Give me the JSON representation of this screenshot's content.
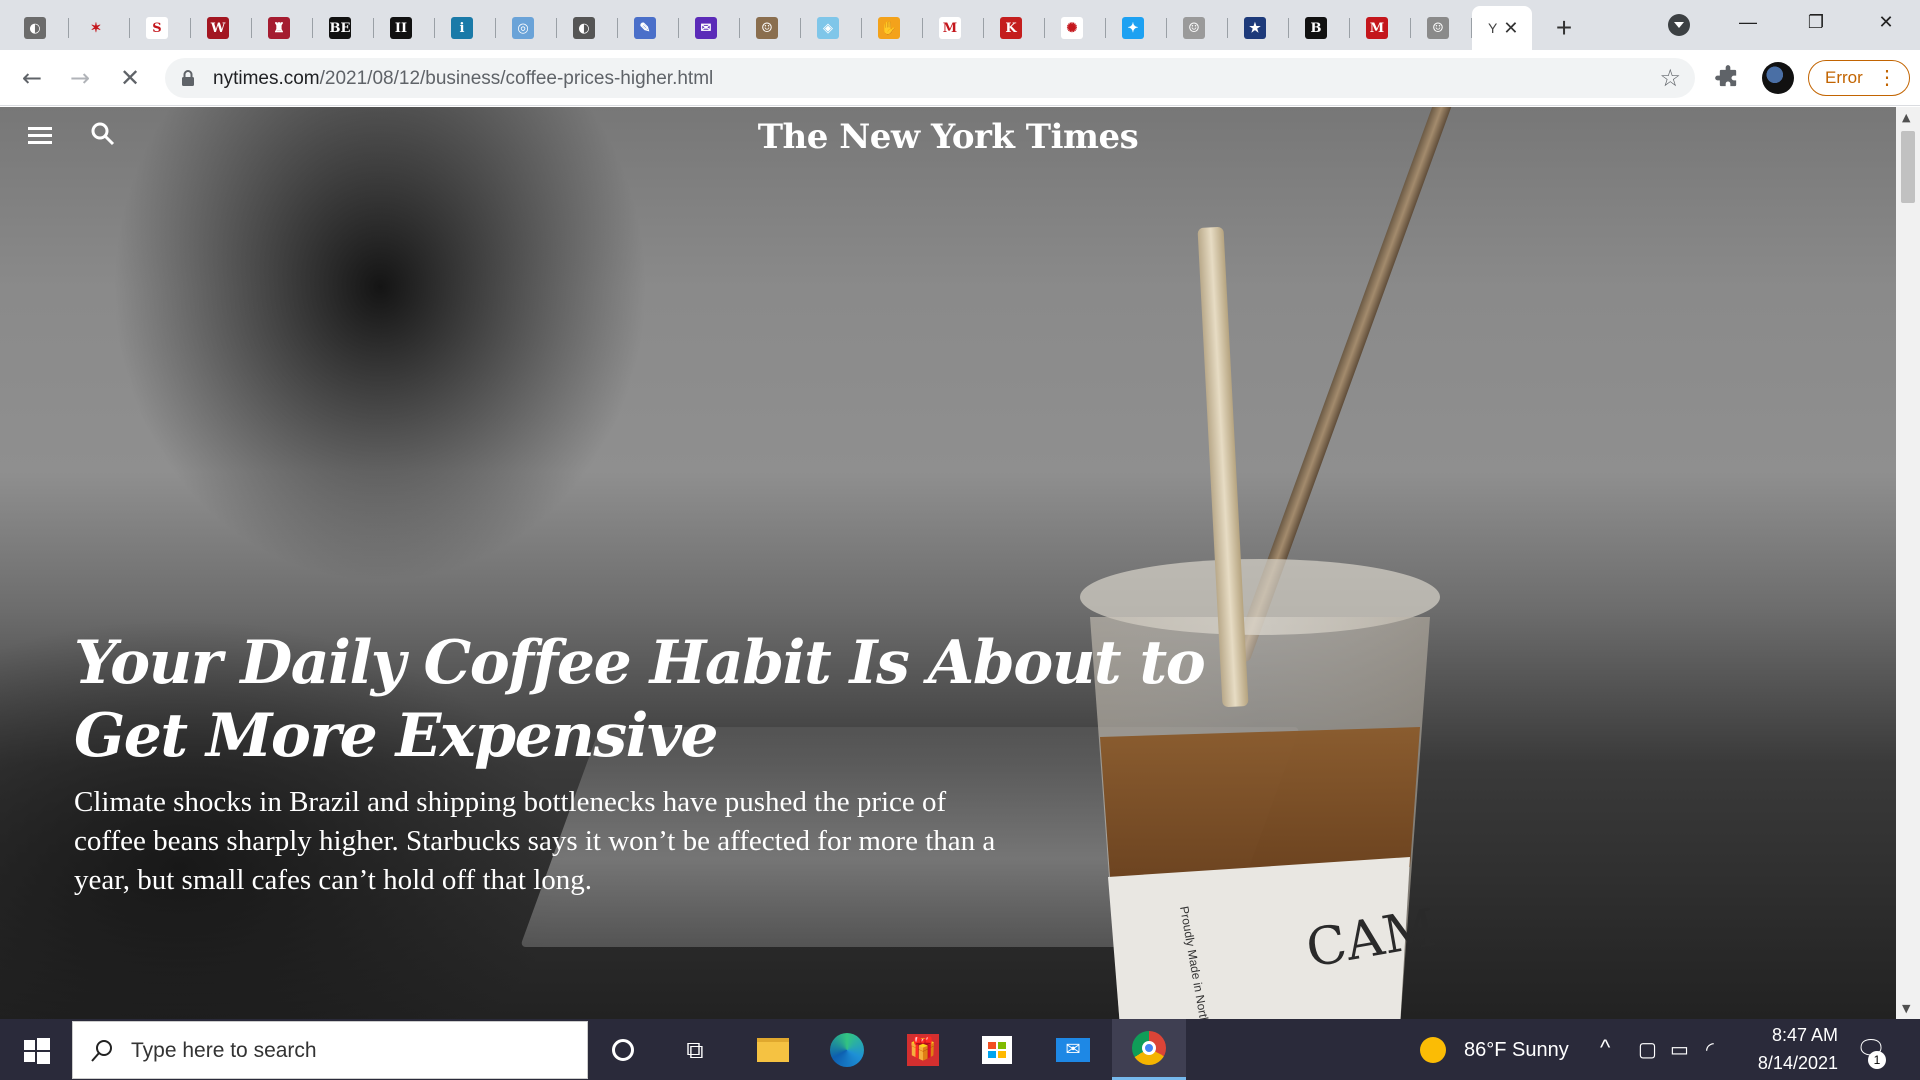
{
  "browser": {
    "tabs": [
      {
        "icon": "globe-icon",
        "bg": "#6b6b6b",
        "glyph": "◐"
      },
      {
        "icon": "stars-icon",
        "bg": "#dee1e6",
        "glyph": "✶"
      },
      {
        "icon": "sydney-icon",
        "bg": "#ffffff",
        "glyph": "S"
      },
      {
        "icon": "w-icon",
        "bg": "#a31621",
        "glyph": "W"
      },
      {
        "icon": "harvard-shield-icon",
        "bg": "#a51c30",
        "glyph": "♜"
      },
      {
        "icon": "be-icon",
        "bg": "#111111",
        "glyph": "BE"
      },
      {
        "icon": "ii-icon",
        "bg": "#111111",
        "glyph": "II"
      },
      {
        "icon": "invest-icon",
        "bg": "#1a7aa8",
        "glyph": "i"
      },
      {
        "icon": "un-icon",
        "bg": "#6aa3d8",
        "glyph": "◎"
      },
      {
        "icon": "globe-icon",
        "bg": "#555555",
        "glyph": "◐"
      },
      {
        "icon": "chat-icon",
        "bg": "#4a6fc9",
        "glyph": "✎"
      },
      {
        "icon": "mail-icon",
        "bg": "#5b2bb8",
        "glyph": "✉"
      },
      {
        "icon": "person-photo-icon",
        "bg": "#8a6e4e",
        "glyph": "☺"
      },
      {
        "icon": "shield-icon",
        "bg": "#7fc6e9",
        "glyph": "◈"
      },
      {
        "icon": "hand-icon",
        "bg": "#f3a21b",
        "glyph": "✋"
      },
      {
        "icon": "gmail-icon",
        "bg": "#ffffff",
        "glyph": "M"
      },
      {
        "icon": "k-icon",
        "bg": "#c41e1e",
        "glyph": "K"
      },
      {
        "icon": "nbc-peacock-icon",
        "bg": "#ffffff",
        "glyph": "✺"
      },
      {
        "icon": "twitter-icon",
        "bg": "#1da1f2",
        "glyph": "✦"
      },
      {
        "icon": "person-photo-icon",
        "bg": "#9a9a9a",
        "glyph": "☺"
      },
      {
        "icon": "star-flag-icon",
        "bg": "#1d3a7a",
        "glyph": "★"
      },
      {
        "icon": "b-icon",
        "bg": "#111111",
        "glyph": "B"
      },
      {
        "icon": "m-icon",
        "bg": "#c4161c",
        "glyph": "M"
      },
      {
        "icon": "person-photo-icon",
        "bg": "#8a8a8a",
        "glyph": "☺"
      }
    ],
    "active_tab": {
      "title": "Y",
      "close": "✕"
    },
    "new_tab": "+",
    "window": {
      "minimize": "—",
      "restore": "❐",
      "close": "✕"
    },
    "url_domain": "nytimes.com",
    "url_path": "/2021/08/12/business/coffee-prices-higher.html",
    "error_button": "Error"
  },
  "page": {
    "masthead": "The New York Times",
    "headline": "Your Daily Coffee Habit Is About to Get More Expensive",
    "summary": "Climate shocks in Brazil and shipping bottlenecks have pushed the price of coffee beans sharply higher. Starbucks says it won’t be affected for more than a year, but small cafes can’t hold off that long.",
    "cup_sleeve_text": "Proudly Made in North America",
    "cup_brand": "CAM"
  },
  "taskbar": {
    "search_placeholder": "Type here to search",
    "weather": "86°F  Sunny",
    "time": "8:47 AM",
    "date": "8/14/2021",
    "notifications": "1"
  }
}
